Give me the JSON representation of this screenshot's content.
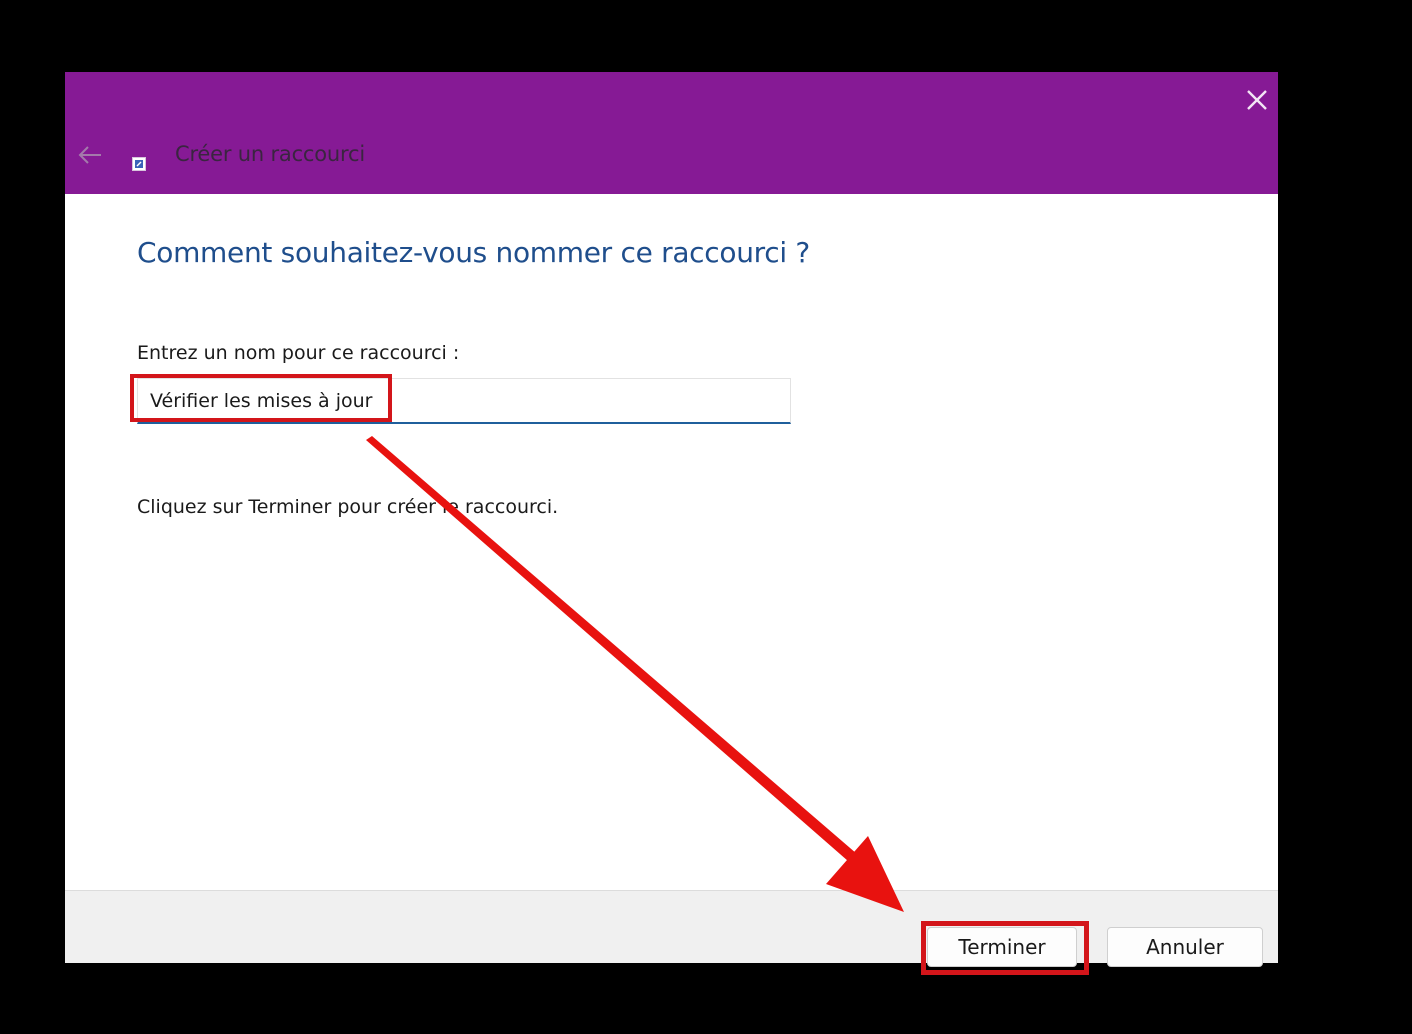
{
  "window": {
    "title": "Créer un raccourci",
    "close_icon": "close-icon",
    "back_icon": "back-arrow-icon",
    "title_icon": "shortcut-icon",
    "titlebar_color": "#861a95"
  },
  "main": {
    "heading": "Comment souhaitez-vous nommer ce raccourci ?",
    "name_label": "Entrez un nom pour ce raccourci :",
    "name_value": "Vérifier les mises à jour",
    "instruction": "Cliquez sur Terminer pour créer le raccourci."
  },
  "footer": {
    "finish_label": "Terminer",
    "cancel_label": "Annuler"
  },
  "annotation": {
    "highlight_color": "#d3151a"
  }
}
